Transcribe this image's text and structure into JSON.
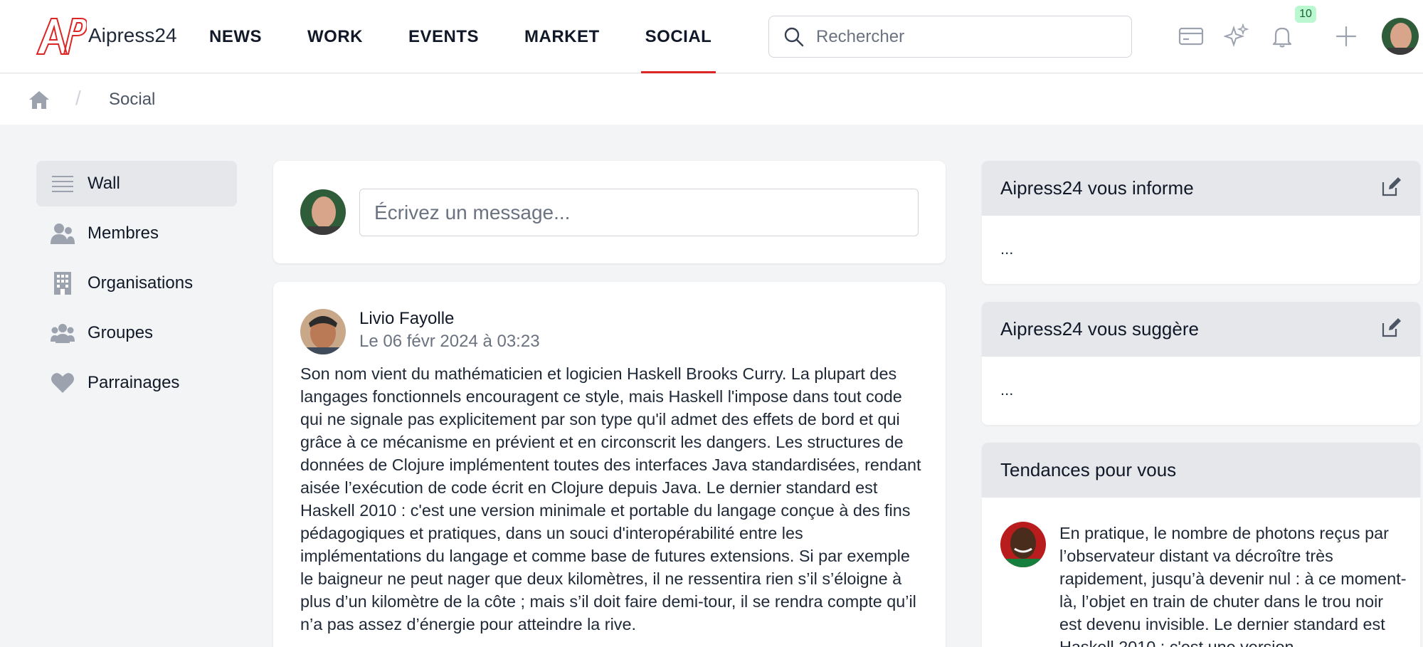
{
  "app": {
    "logo_text": "Aipress24",
    "brand_color": "#dc2626"
  },
  "nav": {
    "items": [
      {
        "label": "NEWS"
      },
      {
        "label": "WORK"
      },
      {
        "label": "EVENTS"
      },
      {
        "label": "MARKET"
      },
      {
        "label": "SOCIAL"
      }
    ],
    "active": "SOCIAL"
  },
  "search": {
    "placeholder": "Rechercher"
  },
  "toolbar": {
    "icons": [
      "card-icon",
      "sparkles-icon",
      "bell-icon",
      "plus-icon"
    ],
    "notification_count": "10"
  },
  "breadcrumb": {
    "current": "Social",
    "separator": "/"
  },
  "sidebar": {
    "items": [
      {
        "label": "Wall",
        "icon": "list-icon",
        "active": true
      },
      {
        "label": "Membres",
        "icon": "users-icon"
      },
      {
        "label": "Organisations",
        "icon": "building-icon"
      },
      {
        "label": "Groupes",
        "icon": "group-icon"
      },
      {
        "label": "Parrainages",
        "icon": "heart-icon"
      }
    ]
  },
  "composer": {
    "placeholder": "Écrivez un message..."
  },
  "post": {
    "author": "Livio Fayolle",
    "date": "Le 06 févr 2024 à 03:23",
    "body": "Son nom vient du mathématicien et logicien Haskell Brooks Curry. La plupart des langages fonctionnels encouragent ce style, mais Haskell l'impose dans tout code qui ne signale pas explicitement par son type qu'il admet des effets de bord et qui grâce à ce mécanisme en prévient et en circonscrit les dangers. Les structures de données de Clojure implémentent toutes des interfaces Java standardisées, rendant aisée l’exécution de code écrit en Clojure depuis Java. Le dernier standard est Haskell 2010 : c'est une version minimale et portable du langage conçue à des fins pédagogiques et pratiques, dans un souci d'interopérabilité entre les implémentations du langage et comme base de futures extensions. Si par exemple le baigneur ne peut nager que deux kilomètres, il ne ressentira rien s’il s’éloigne à plus d’un kilomètre de la côte ; mais s’il doit faire demi-tour, il se rendra compte qu’il n’a pas assez d’énergie pour atteindre la rive."
  },
  "panels": {
    "informe": {
      "title": "Aipress24 vous informe",
      "body": "..."
    },
    "suggere": {
      "title": "Aipress24 vous suggère",
      "body": "..."
    },
    "tendances": {
      "title": "Tendances pour vous",
      "text": "En pratique, le nombre de photons reçus par l’observateur distant va décroître très rapidement, jusqu’à devenir nul : à ce moment-là, l’objet en train de chuter dans le trou noir est devenu invisible. Le dernier standard est Haskell 2010 : c'est une version"
    }
  }
}
